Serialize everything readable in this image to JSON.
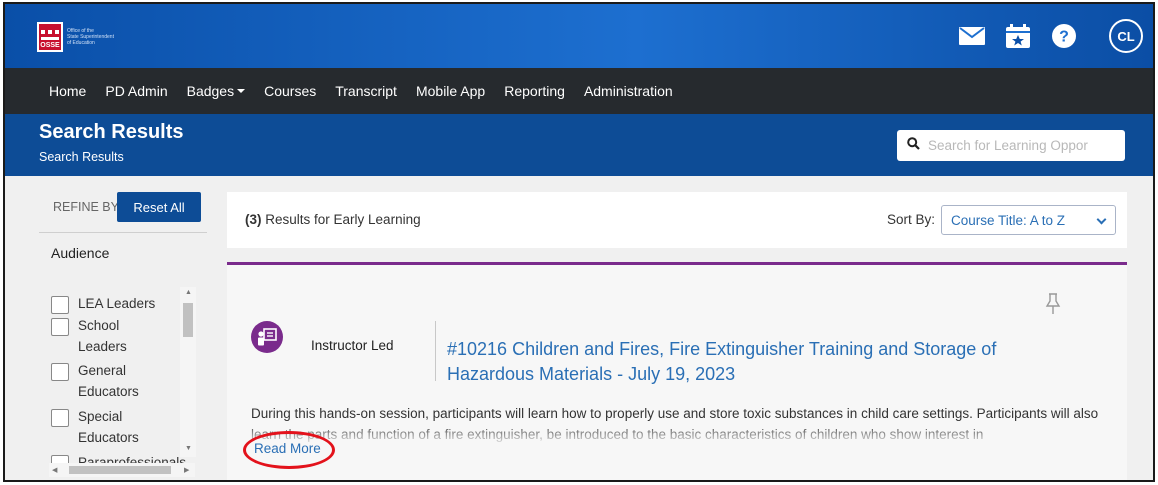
{
  "header": {
    "logo_text": "OSSE",
    "logo_subtext": [
      "Office of the",
      "State Superintendent",
      "of Education"
    ],
    "user_initials": "CL"
  },
  "nav": {
    "items": [
      {
        "label": "Home"
      },
      {
        "label": "PD Admin"
      },
      {
        "label": "Badges",
        "dropdown": true
      },
      {
        "label": "Courses"
      },
      {
        "label": "Transcript"
      },
      {
        "label": "Mobile App"
      },
      {
        "label": "Reporting"
      },
      {
        "label": "Administration"
      }
    ]
  },
  "title_band": {
    "title": "Search Results",
    "breadcrumb": "Search Results",
    "search_placeholder": "Search for Learning Oppor"
  },
  "sidebar": {
    "refine_label": "REFINE BY",
    "reset_label": "Reset All",
    "audience_title": "Audience",
    "audience_items": [
      {
        "label": "LEA Leaders"
      },
      {
        "label": "School Leaders"
      },
      {
        "label": "General Educators"
      },
      {
        "label": "Special Educators"
      },
      {
        "label": "Paraprofessionals"
      }
    ]
  },
  "results": {
    "count_prefix": "(3)",
    "count_text": "Results for Early Learning",
    "sort_label": "Sort By:",
    "sort_value": "Course Title: A to Z"
  },
  "course": {
    "type": "Instructor Led",
    "title": "#10216 Children and Fires, Fire Extinguisher Training and Storage of Hazardous Materials - July 19, 2023",
    "description": "During this hands-on session, participants will learn how to properly use and store toxic substances in child care settings. Participants will also learn the parts and function of a fire extinguisher, be introduced to the basic characteristics of children who show interest in",
    "read_more": "Read More"
  },
  "colors": {
    "header_blue": "#0a4fa8",
    "nav_dark": "#262a2e",
    "accent_purple": "#7a2b8c",
    "link_blue": "#2a6fb5",
    "annotation_red": "#e3121b"
  }
}
